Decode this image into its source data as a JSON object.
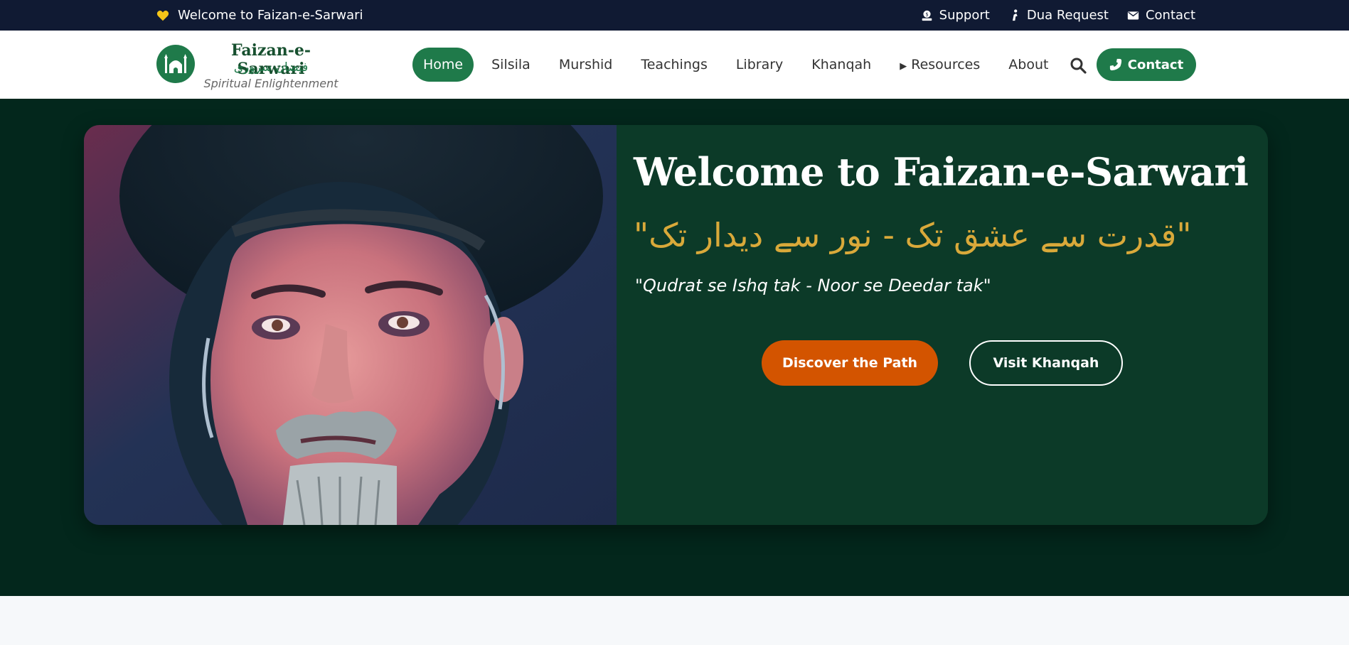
{
  "topbar": {
    "welcome": "Welcome to Faizan-e-Sarwari",
    "links": [
      {
        "label": "Support",
        "icon": "donate-icon"
      },
      {
        "label": "Dua Request",
        "icon": "praying-hands-icon"
      },
      {
        "label": "Contact",
        "icon": "envelope-icon"
      }
    ]
  },
  "brand": {
    "title": "Faizan-e-Sarwari",
    "urdu": "فیضان سروری",
    "tagline": "Spiritual Enlightenment",
    "icon": "mosque-icon"
  },
  "nav": {
    "items": [
      "Home",
      "Silsila",
      "Murshid",
      "Teachings",
      "Library",
      "Khanqah",
      "Resources",
      "About"
    ],
    "active": "Home",
    "contact_label": "Contact"
  },
  "hero": {
    "title": "Welcome to Faizan-e-Sarwari",
    "urdu_quote": "\"قدرت سے عشق تک - نور سے دیدار تک\"",
    "quote": "\"Qudrat se Ishq tak - Noor se Deedar tak\"",
    "primary_button": "Discover the Path",
    "secondary_button": "Visit Khanqah"
  },
  "colors": {
    "topbar_bg": "#101a33",
    "brand_green": "#1f7a4a",
    "hero_bg": "#03271c",
    "card_bg": "#0c3a28",
    "gold": "#d9a93a",
    "orange": "#d35400"
  }
}
